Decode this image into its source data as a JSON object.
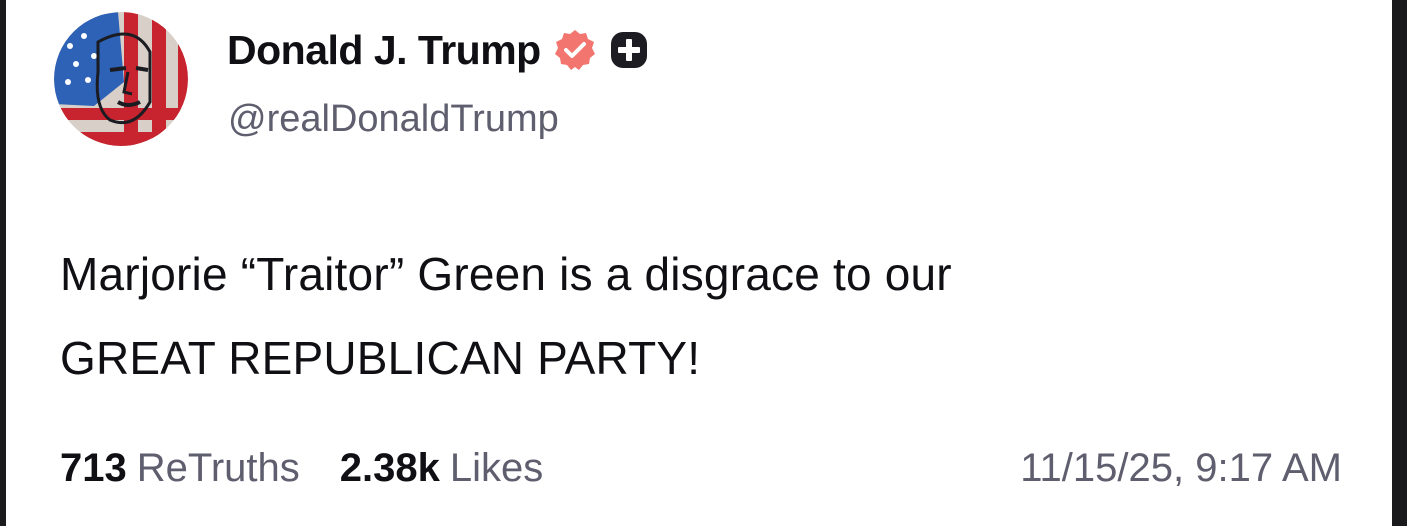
{
  "colors": {
    "background": "#ffffff",
    "text_primary": "#0f0f14",
    "text_secondary": "#5e5e6e",
    "verified_badge": "#f2766f",
    "plus_badge": "#1c1c22"
  },
  "author": {
    "display_name": "Donald J. Trump",
    "handle": "@realDonaldTrump",
    "avatar_icon": "avatar-flag-portrait",
    "badges": [
      "verified-icon",
      "plus-icon"
    ]
  },
  "post": {
    "lines": [
      "Marjorie “Traitor” Green is a disgrace to our",
      "GREAT REPUBLICAN PARTY!"
    ]
  },
  "stats": {
    "retruths_count": "713",
    "retruths_label": "ReTruths",
    "likes_count": "2.38k",
    "likes_label": "Likes"
  },
  "timestamp": "11/15/25, 9:17 AM"
}
